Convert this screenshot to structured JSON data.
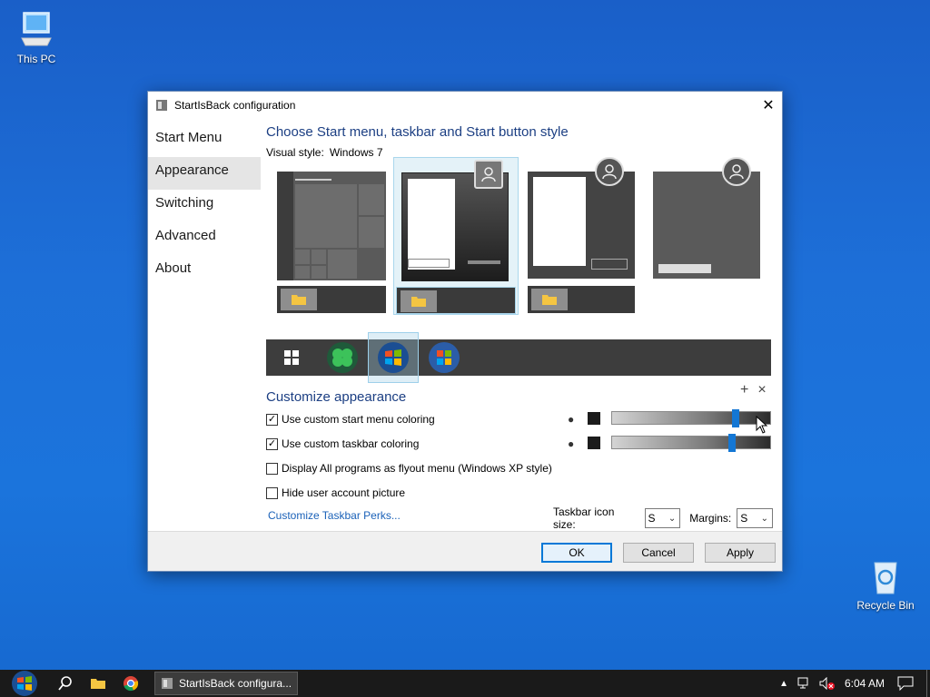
{
  "desktop": {
    "this_pc_label": "This PC",
    "recycle_bin_label": "Recycle Bin"
  },
  "dialog": {
    "title": "StartIsBack configuration",
    "close_glyph": "✕",
    "nav": {
      "items": [
        {
          "label": "Start Menu",
          "selected": false
        },
        {
          "label": "Appearance",
          "selected": true
        },
        {
          "label": "Switching",
          "selected": false
        },
        {
          "label": "Advanced",
          "selected": false
        },
        {
          "label": "About",
          "selected": false
        }
      ]
    },
    "appearance": {
      "heading": "Choose Start menu, taskbar and Start button style",
      "visual_style_label": "Visual style:",
      "visual_style_value": "Windows 7",
      "styles": [
        {
          "name": "windows-10-style",
          "selected": false
        },
        {
          "name": "windows-7-style",
          "selected": true
        },
        {
          "name": "plain-8-style",
          "selected": false
        },
        {
          "name": "flat-style",
          "selected": false
        }
      ],
      "orbs": [
        {
          "name": "windows-logo-orb",
          "selected": false
        },
        {
          "name": "clover-orb",
          "selected": false
        },
        {
          "name": "windows-7-orb",
          "selected": true
        },
        {
          "name": "windows-orb-alt",
          "selected": false
        }
      ],
      "customize_heading": "Customize appearance",
      "options": [
        {
          "label": "Use custom start menu coloring",
          "checked": true
        },
        {
          "label": "Use custom taskbar coloring",
          "checked": true
        },
        {
          "label": "Display All programs as flyout menu (Windows XP style)",
          "checked": false
        },
        {
          "label": "Hide user account picture",
          "checked": false
        }
      ],
      "start_menu_color_value": 0.8,
      "taskbar_color_value": 0.78,
      "perks_link": "Customize Taskbar Perks...",
      "icon_size_label": "Taskbar icon size:",
      "icon_size_value": "S",
      "margins_label": "Margins:",
      "margins_value": "S"
    },
    "buttons": {
      "ok": "OK",
      "cancel": "Cancel",
      "apply": "Apply"
    }
  },
  "taskbar": {
    "task_label": "StartIsBack configura...",
    "clock": "6:04 AM"
  },
  "colors": {
    "heading_blue": "#1c3f83",
    "link_blue": "#1a61b8",
    "accent": "#0078d7",
    "slider_knob": "#1477d4"
  }
}
